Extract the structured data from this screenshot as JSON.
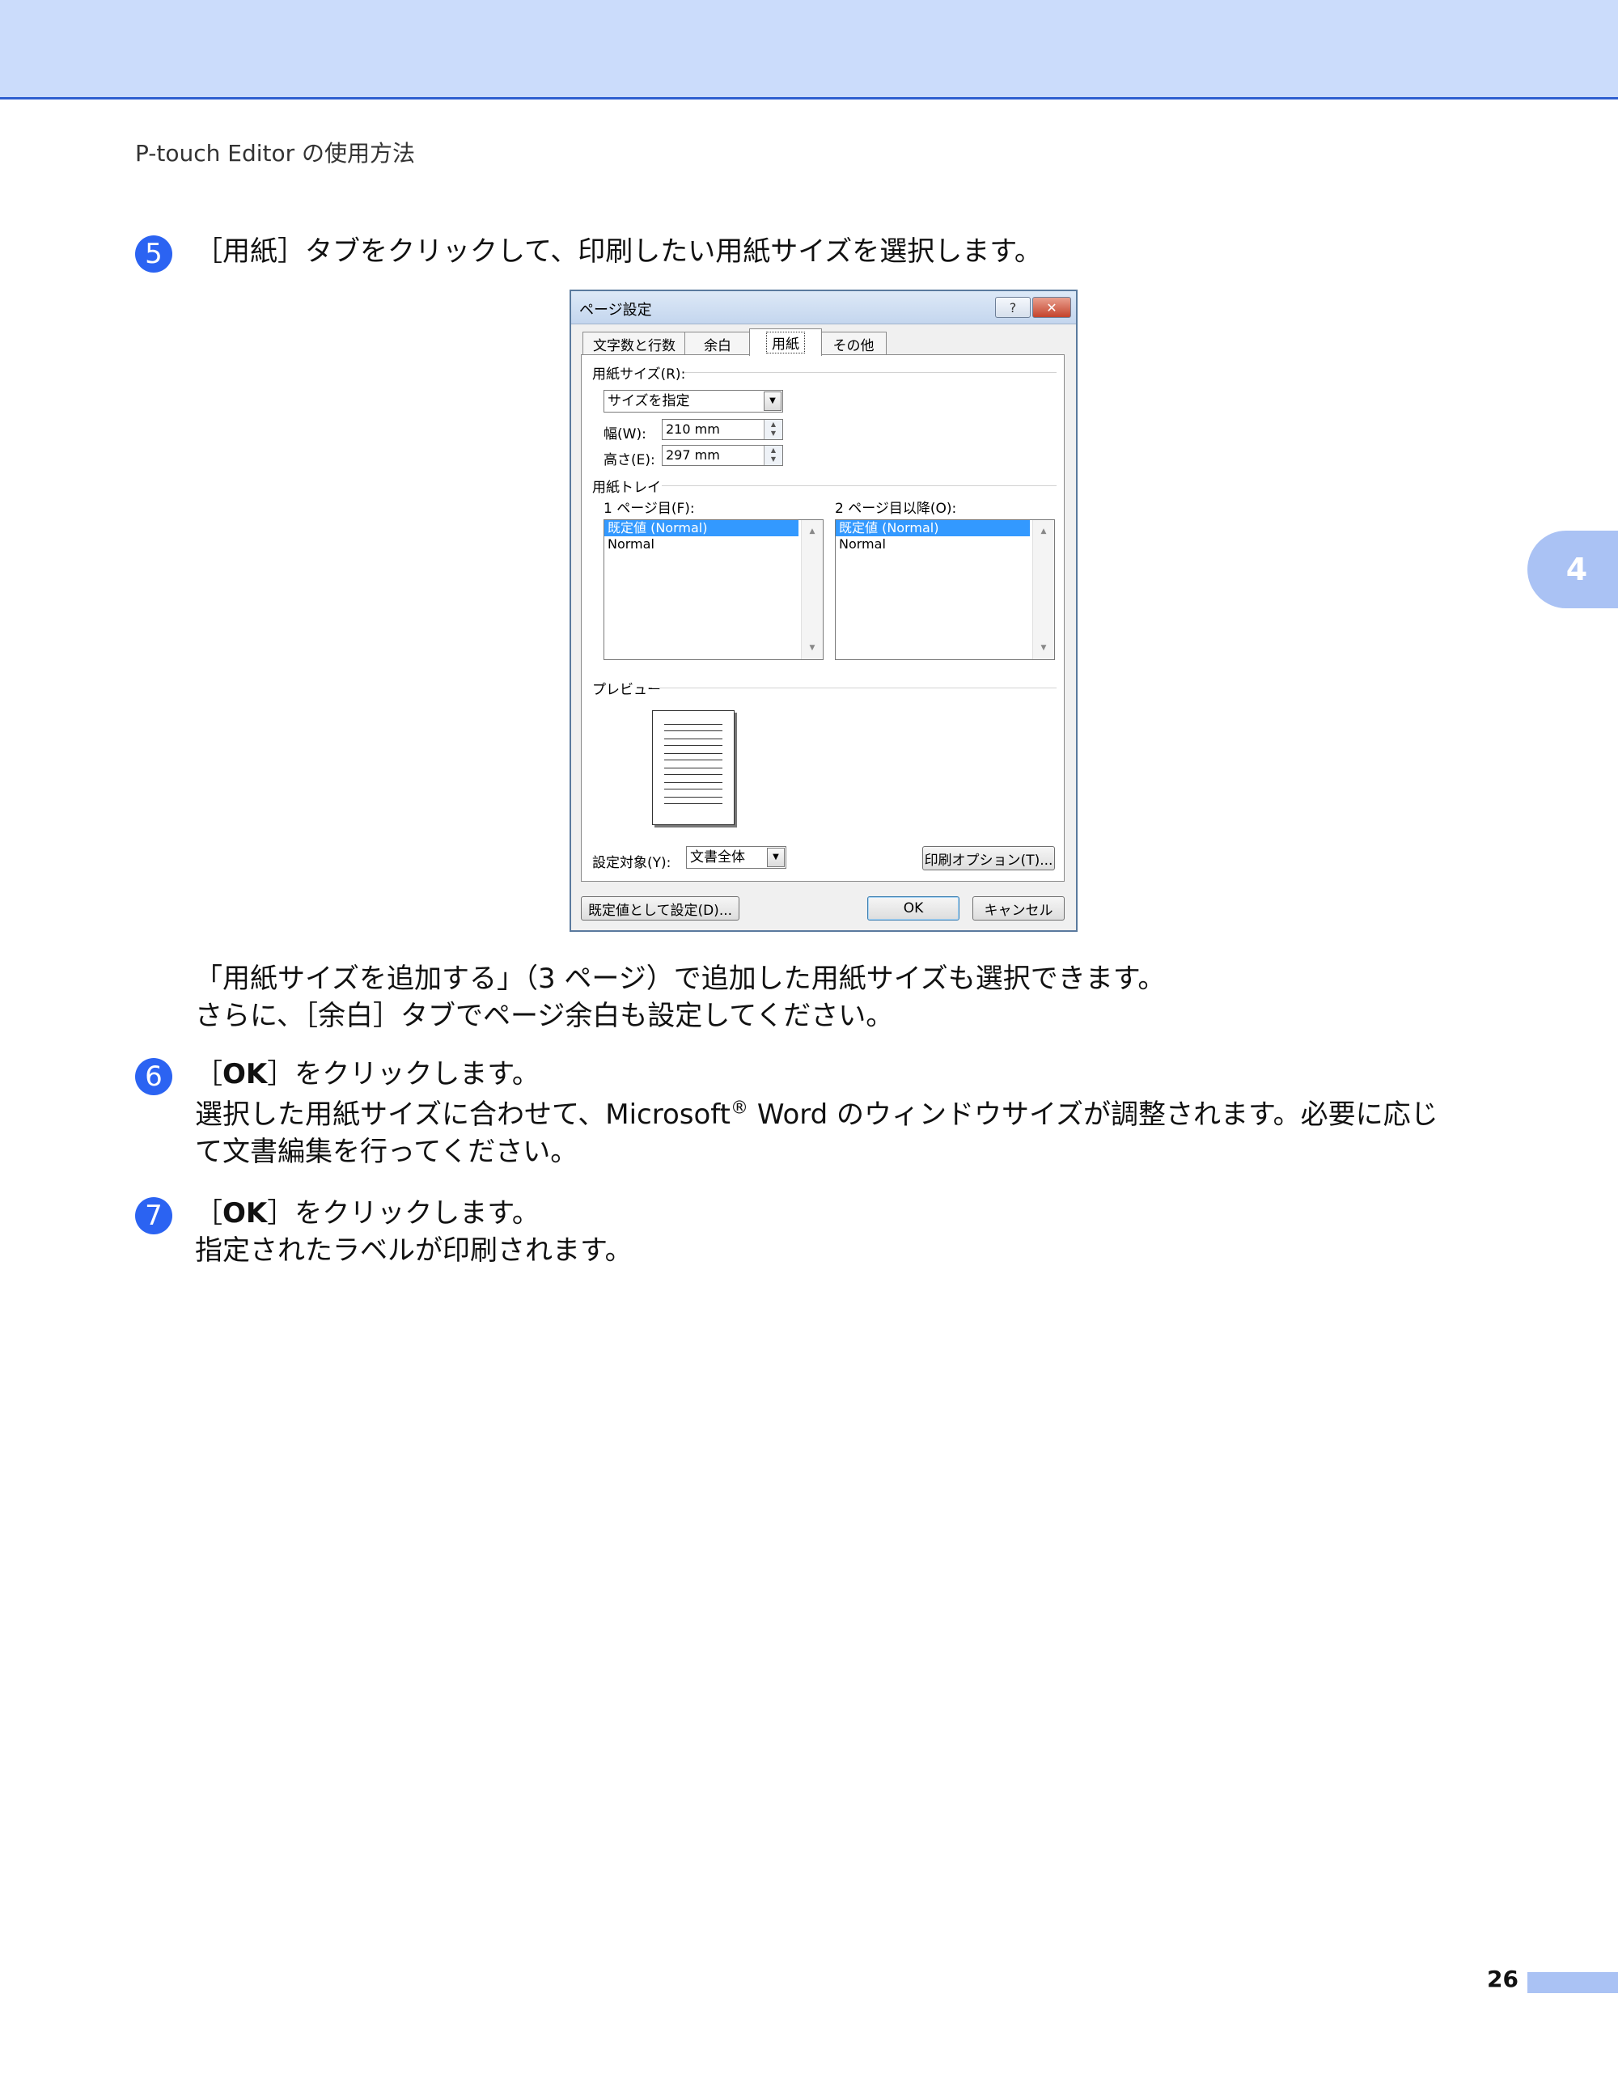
{
  "header": {
    "running_title": "P-touch Editor の使用方法",
    "chapter_tab": "4"
  },
  "steps": {
    "s5": {
      "number": "5",
      "text": "［用紙］タブをクリックして、印刷したい用紙サイズを選択します。"
    },
    "after5": {
      "line1": "「用紙サイズを追加する」（3 ページ）で追加した用紙サイズも選択できます。",
      "line2": "さらに、［余白］タブでページ余白も設定してください。"
    },
    "s6": {
      "number": "6",
      "pre": "［",
      "bold": "OK",
      "post": "］をクリックします。",
      "body1_pre": "選択した用紙サイズに合わせて、Microsoft",
      "reg": "®",
      "body1_post": " Word のウィンドウサイズが調整されます。必要に応じ",
      "body2": "て文書編集を行ってください。"
    },
    "s7": {
      "number": "7",
      "pre": "［",
      "bold": "OK",
      "post": "］をクリックします。",
      "body": "指定されたラベルが印刷されます。"
    }
  },
  "dialog": {
    "title": "ページ設定",
    "help": "?",
    "close": "✕",
    "tabs": [
      "文字数と行数",
      "余白",
      "用紙",
      "その他"
    ],
    "paper_size_label": "用紙サイズ(R):",
    "paper_size_value": "サイズを指定",
    "width_label": "幅(W):",
    "width_value": "210 mm",
    "height_label": "高さ(E):",
    "height_value": "297 mm",
    "tray_label": "用紙トレイ",
    "first_page_label": "1 ページ目(F):",
    "other_pages_label": "2 ページ目以降(O):",
    "first_page_items": [
      "既定値 (Normal)",
      "Normal"
    ],
    "other_pages_items": [
      "既定値 (Normal)",
      "Normal"
    ],
    "preview_label": "プレビュー",
    "apply_to_label": "設定対象(Y):",
    "apply_to_value": "文書全体",
    "print_options": "印刷オプション(T)...",
    "set_default": "既定値として設定(D)...",
    "ok": "OK",
    "cancel": "キャンセル"
  },
  "footer": {
    "page_number": "26"
  }
}
